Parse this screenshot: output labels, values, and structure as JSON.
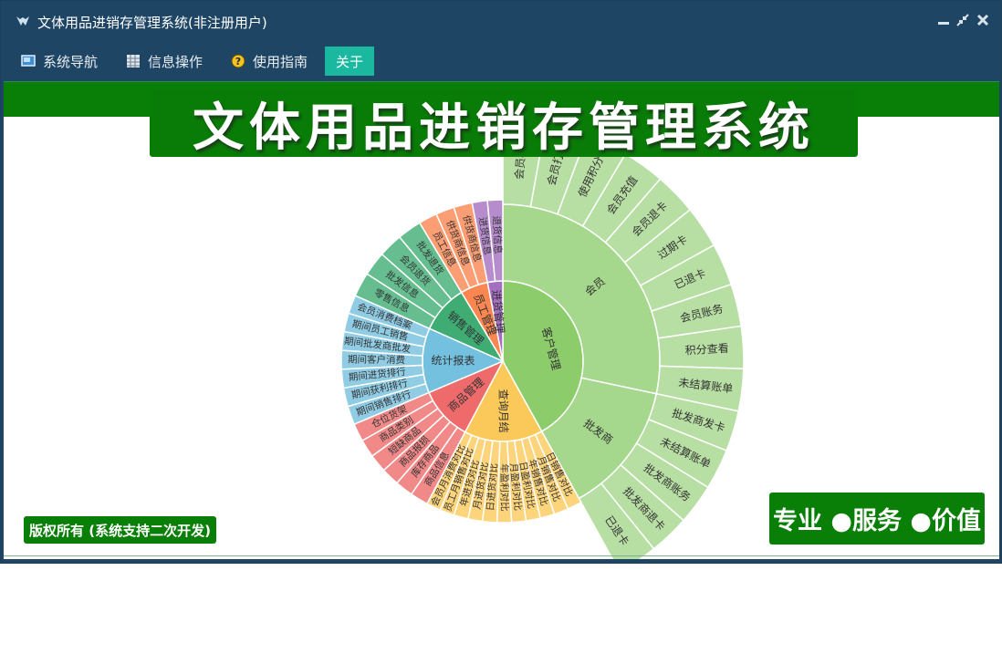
{
  "window": {
    "title": "文体用品进销存管理系统(非注册用户)",
    "controls": [
      "minimize-icon",
      "restore-icon",
      "close-icon"
    ]
  },
  "menubar": {
    "items": [
      {
        "label": "系统导航",
        "icon": "nav-icon"
      },
      {
        "label": "信息操作",
        "icon": "grid-icon"
      },
      {
        "label": "使用指南",
        "icon": "help-icon"
      },
      {
        "label": "关于",
        "icon": ""
      }
    ]
  },
  "banner": {
    "title": "文体用品进销存管理系统"
  },
  "footer": {
    "copyright": "版权所有 (系统支持二次开发)",
    "slogan": "专业 ●服务 ●价值"
  },
  "colors": {
    "titlebar": "#1f4565",
    "active_tab": "#1ab99f",
    "banner_green": "#087c07"
  },
  "chart_data": {
    "type": "sunburst",
    "nodes": [
      {
        "name": "客户管理",
        "color": "#8ccc6b",
        "children": [
          {
            "name": "会员",
            "children": [
              "会员积分",
              "会员打折",
              "使用积分",
              "会员充值",
              "会员退卡",
              "过期卡",
              "已退卡",
              "会员账务",
              "积分查看",
              "未结算账单"
            ]
          },
          {
            "name": "批发商",
            "children": [
              "批发商发卡",
              "未结算账单",
              "批发商账务",
              "批发商退卡",
              "已退卡"
            ]
          }
        ]
      },
      {
        "name": "查询月结",
        "color": "#fbc95a",
        "children": [
          "日销售对比",
          "月销售对比",
          "年销售对比",
          "日盈利对比",
          "月盈利对比",
          "年盈利对比",
          "日进货对比",
          "月进货对比",
          "年进货对比",
          "员工月销售对比",
          "会员月消费对比"
        ]
      },
      {
        "name": "商品管理",
        "color": "#ef6b6b",
        "children": [
          "商品信息",
          "库存商品",
          "商品报损",
          "短缺商品",
          "商品类别",
          "仓位货架"
        ]
      },
      {
        "name": "统计报表",
        "color": "#74c0df",
        "children": [
          "期间销售排行",
          "期间获利排行",
          "期间进货排行",
          "期间客户消费",
          "期间批发商批发",
          "期间员工销售",
          "会员消费档案"
        ]
      },
      {
        "name": "销售管理",
        "color": "#3fac74",
        "children": [
          "零售信息",
          "批发信息",
          "会员退货",
          "批发退货"
        ]
      },
      {
        "name": "员工管理",
        "color": "#fb8650",
        "children": [
          "员工信息",
          "供货商信息",
          "供货商信息"
        ]
      },
      {
        "name": "进货管理",
        "color": "#a46fc0",
        "children": [
          "进货信息",
          "退货信息"
        ]
      }
    ]
  }
}
